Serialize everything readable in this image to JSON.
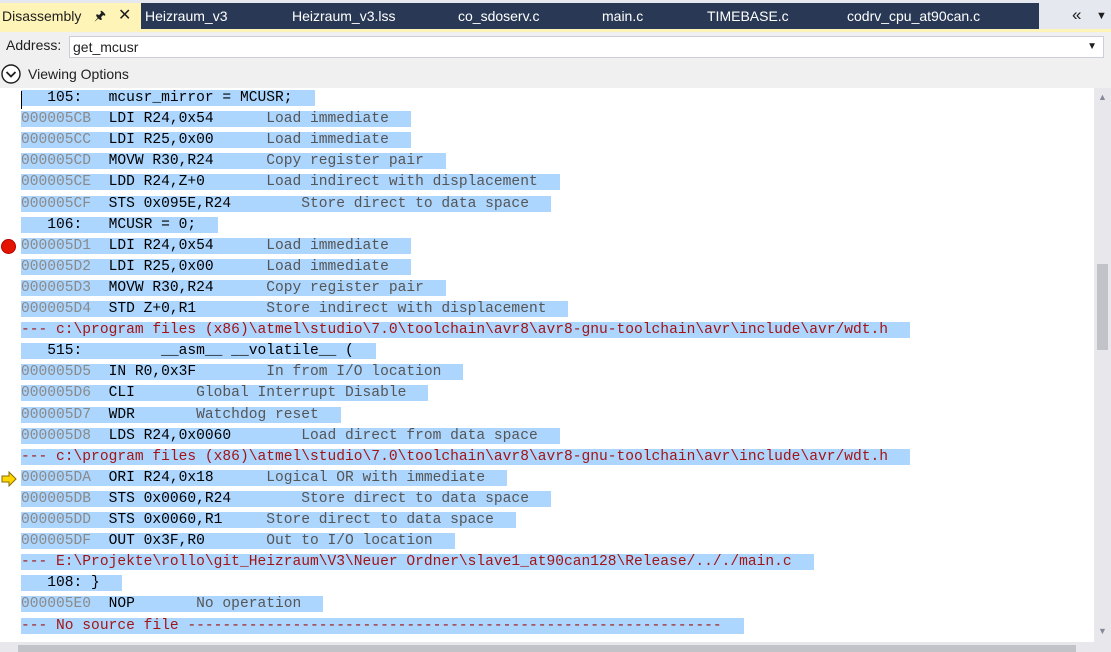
{
  "tabs": [
    {
      "label": "Disassembly",
      "active": true
    },
    {
      "label": "Heizraum_v3",
      "active": false
    },
    {
      "label": "Heizraum_v3.lss",
      "active": false
    },
    {
      "label": "co_sdoserv.c",
      "active": false
    },
    {
      "label": "main.c",
      "active": false
    },
    {
      "label": "TIMEBASE.c",
      "active": false
    },
    {
      "label": "codrv_cpu_at90can.c",
      "active": false
    }
  ],
  "tab_icons": {
    "pin": "pin-icon",
    "close": "close-icon",
    "overflow": "double-chevron-left-icon",
    "dropdown": "chevron-down-icon"
  },
  "address": {
    "label": "Address:",
    "value": "get_mcusr"
  },
  "viewing_options": {
    "label": "Viewing Options",
    "icon": "chevron-down-circle-icon"
  },
  "lines": [
    {
      "kind": "source",
      "text": "   105:   mcusr_mirror = MCUSR;"
    },
    {
      "kind": "instr",
      "addr": "000005CB",
      "asm": "  LDI R24,0x54      ",
      "desc": "Load immediate"
    },
    {
      "kind": "instr",
      "addr": "000005CC",
      "asm": "  LDI R25,0x00      ",
      "desc": "Load immediate"
    },
    {
      "kind": "instr",
      "addr": "000005CD",
      "asm": "  MOVW R30,R24      ",
      "desc": "Copy register pair"
    },
    {
      "kind": "instr",
      "addr": "000005CE",
      "asm": "  LDD R24,Z+0       ",
      "desc": "Load indirect with displacement"
    },
    {
      "kind": "instr",
      "addr": "000005CF",
      "asm": "  STS 0x095E,R24        ",
      "desc": "Store direct to data space"
    },
    {
      "kind": "source",
      "text": "   106:   MCUSR = 0;"
    },
    {
      "kind": "instr",
      "addr": "000005D1",
      "asm": "  LDI R24,0x54      ",
      "desc": "Load immediate",
      "marker": "breakpoint"
    },
    {
      "kind": "instr",
      "addr": "000005D2",
      "asm": "  LDI R25,0x00      ",
      "desc": "Load immediate"
    },
    {
      "kind": "instr",
      "addr": "000005D3",
      "asm": "  MOVW R30,R24      ",
      "desc": "Copy register pair"
    },
    {
      "kind": "instr",
      "addr": "000005D4",
      "asm": "  STD Z+0,R1        ",
      "desc": "Store indirect with displacement"
    },
    {
      "kind": "file",
      "text": "--- c:\\program files (x86)\\atmel\\studio\\7.0\\toolchain\\avr8\\avr8-gnu-toolchain\\avr\\include\\avr/wdt.h"
    },
    {
      "kind": "source",
      "text": "   515:         __asm__ __volatile__ ("
    },
    {
      "kind": "instr",
      "addr": "000005D5",
      "asm": "  IN R0,0x3F        ",
      "desc": "In from I/O location"
    },
    {
      "kind": "instr",
      "addr": "000005D6",
      "asm": "  CLI       ",
      "desc": "Global Interrupt Disable"
    },
    {
      "kind": "instr",
      "addr": "000005D7",
      "asm": "  WDR       ",
      "desc": "Watchdog reset"
    },
    {
      "kind": "instr",
      "addr": "000005D8",
      "asm": "  LDS R24,0x0060        ",
      "desc": "Load direct from data space"
    },
    {
      "kind": "file",
      "text": "--- c:\\program files (x86)\\atmel\\studio\\7.0\\toolchain\\avr8\\avr8-gnu-toolchain\\avr\\include\\avr/wdt.h"
    },
    {
      "kind": "instr",
      "addr": "000005DA",
      "asm": "  ORI R24,0x18      ",
      "desc": "Logical OR with immediate",
      "marker": "current"
    },
    {
      "kind": "instr",
      "addr": "000005DB",
      "asm": "  STS 0x0060,R24        ",
      "desc": "Store direct to data space"
    },
    {
      "kind": "instr",
      "addr": "000005DD",
      "asm": "  STS 0x0060,R1     ",
      "desc": "Store direct to data space"
    },
    {
      "kind": "instr",
      "addr": "000005DF",
      "asm": "  OUT 0x3F,R0       ",
      "desc": "Out to I/O location"
    },
    {
      "kind": "file",
      "text": "--- E:\\Projekte\\rollo\\git_Heizraum\\V3\\Neuer Ordner\\slave1_at90can128\\Release/.././main.c"
    },
    {
      "kind": "source",
      "text": "   108: }"
    },
    {
      "kind": "instr",
      "addr": "000005E0",
      "asm": "  NOP       ",
      "desc": "No operation"
    },
    {
      "kind": "file",
      "text": "--- No source file -------------------------------------------------------------"
    }
  ],
  "colors": {
    "selection": "#add6ff",
    "file_header": "#a31515",
    "address": "#8a8a8a",
    "tab_active": "#fff4b8",
    "tab_inactive": "#293955",
    "breakpoint": "#e51400",
    "instruction_pointer": "#ffd700"
  },
  "scroll_icons": {
    "up": "scroll-up-arrow-icon",
    "down": "scroll-down-arrow-icon"
  }
}
